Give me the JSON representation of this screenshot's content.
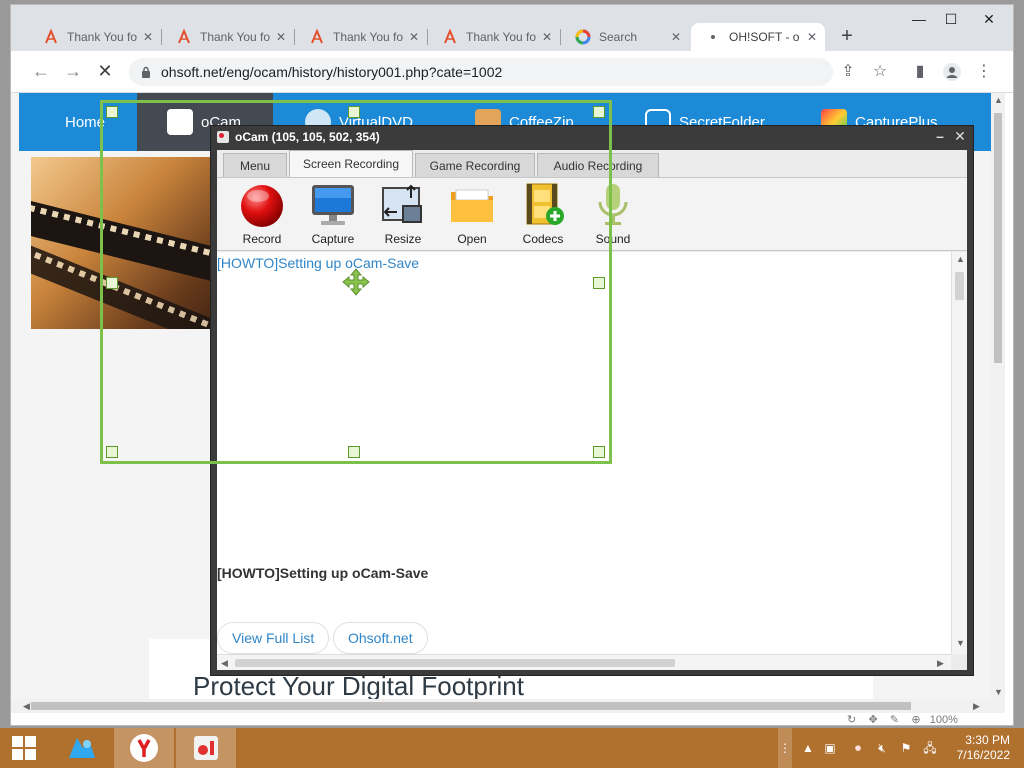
{
  "browser": {
    "tabs": [
      {
        "title": "Thank You fo",
        "icon": "pdf-tab-icon",
        "active": false
      },
      {
        "title": "Thank You fo",
        "icon": "pdf-tab-icon",
        "active": false
      },
      {
        "title": "Thank You fo",
        "icon": "pdf-tab-icon",
        "active": false
      },
      {
        "title": "Thank You fo",
        "icon": "pdf-tab-icon",
        "active": false
      },
      {
        "title": "Search",
        "icon": "google-tab-icon",
        "active": false
      },
      {
        "title": "OH!SOFT - o",
        "icon": "loading-tab-icon",
        "active": true
      }
    ],
    "new_tab_label": "+",
    "url": "ohsoft.net/eng/ocam/history/history001.php?cate=1002"
  },
  "site": {
    "nav": [
      {
        "label": "Home"
      },
      {
        "label": "oCam"
      },
      {
        "label": "VirtualDVD"
      },
      {
        "label": "CoffeeZip"
      },
      {
        "label": "SecretFolder"
      },
      {
        "label": "CapturePlus"
      }
    ],
    "footer_heading": "Protect Your Digital Footprint",
    "zoom": "100%"
  },
  "ocam": {
    "title": "oCam (105, 105, 502, 354)",
    "tabs": [
      "Menu",
      "Screen Recording",
      "Game Recording",
      "Audio Recording"
    ],
    "active_tab": "Screen Recording",
    "tools": [
      {
        "label": "Record",
        "icon": "record-icon"
      },
      {
        "label": "Capture",
        "icon": "monitor-capture-icon"
      },
      {
        "label": "Resize",
        "icon": "resize-icon"
      },
      {
        "label": "Open",
        "icon": "folder-icon"
      },
      {
        "label": "Codecs",
        "icon": "codecs-icon"
      },
      {
        "label": "Sound",
        "icon": "microphone-icon"
      }
    ],
    "content": {
      "link": "[HOWTO]Setting up oCam-Save",
      "post_title": "[HOWTO]Setting up oCam-Save",
      "buttons": [
        "View Full List",
        "Ohsoft.net"
      ]
    }
  },
  "taskbar": {
    "time": "3:30 PM",
    "date": "7/16/2022"
  },
  "colors": {
    "site_nav": "#1c8ad6",
    "region_border": "#7cc24a",
    "taskbar": "#b0702e",
    "link": "#2f86c9"
  }
}
